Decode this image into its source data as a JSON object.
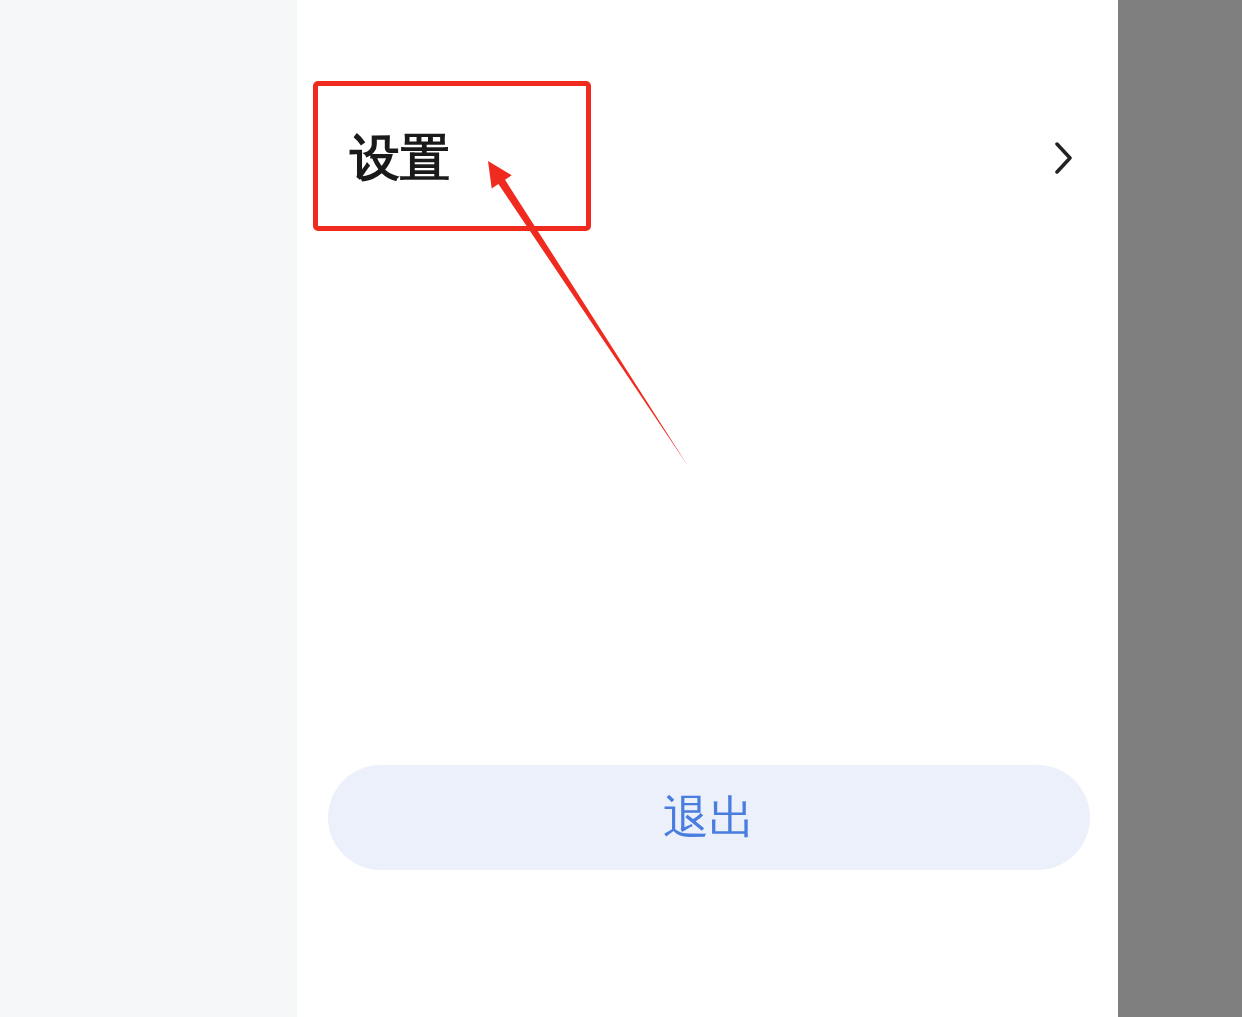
{
  "menu_items": [
    {
      "label": "设置"
    }
  ],
  "exit_button": {
    "label": "退出"
  }
}
